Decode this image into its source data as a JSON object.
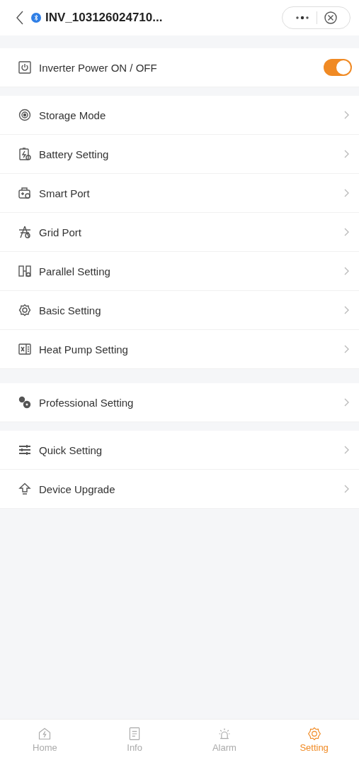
{
  "header": {
    "title": "INV_103126024710...",
    "connected": true
  },
  "power": {
    "label": "Inverter Power ON / OFF",
    "on": true
  },
  "sections": [
    {
      "items": [
        {
          "label": "Storage Mode"
        },
        {
          "label": "Battery Setting"
        },
        {
          "label": "Smart Port"
        },
        {
          "label": "Grid Port"
        },
        {
          "label": "Parallel Setting"
        },
        {
          "label": "Basic Setting"
        },
        {
          "label": "Heat Pump Setting"
        }
      ]
    },
    {
      "items": [
        {
          "label": "Professional Setting"
        }
      ]
    },
    {
      "items": [
        {
          "label": "Quick Setting"
        },
        {
          "label": "Device Upgrade"
        }
      ]
    }
  ],
  "tabs": [
    {
      "label": "Home",
      "selected": false
    },
    {
      "label": "Info",
      "selected": false
    },
    {
      "label": "Alarm",
      "selected": false
    },
    {
      "label": "Setting",
      "selected": true
    }
  ]
}
